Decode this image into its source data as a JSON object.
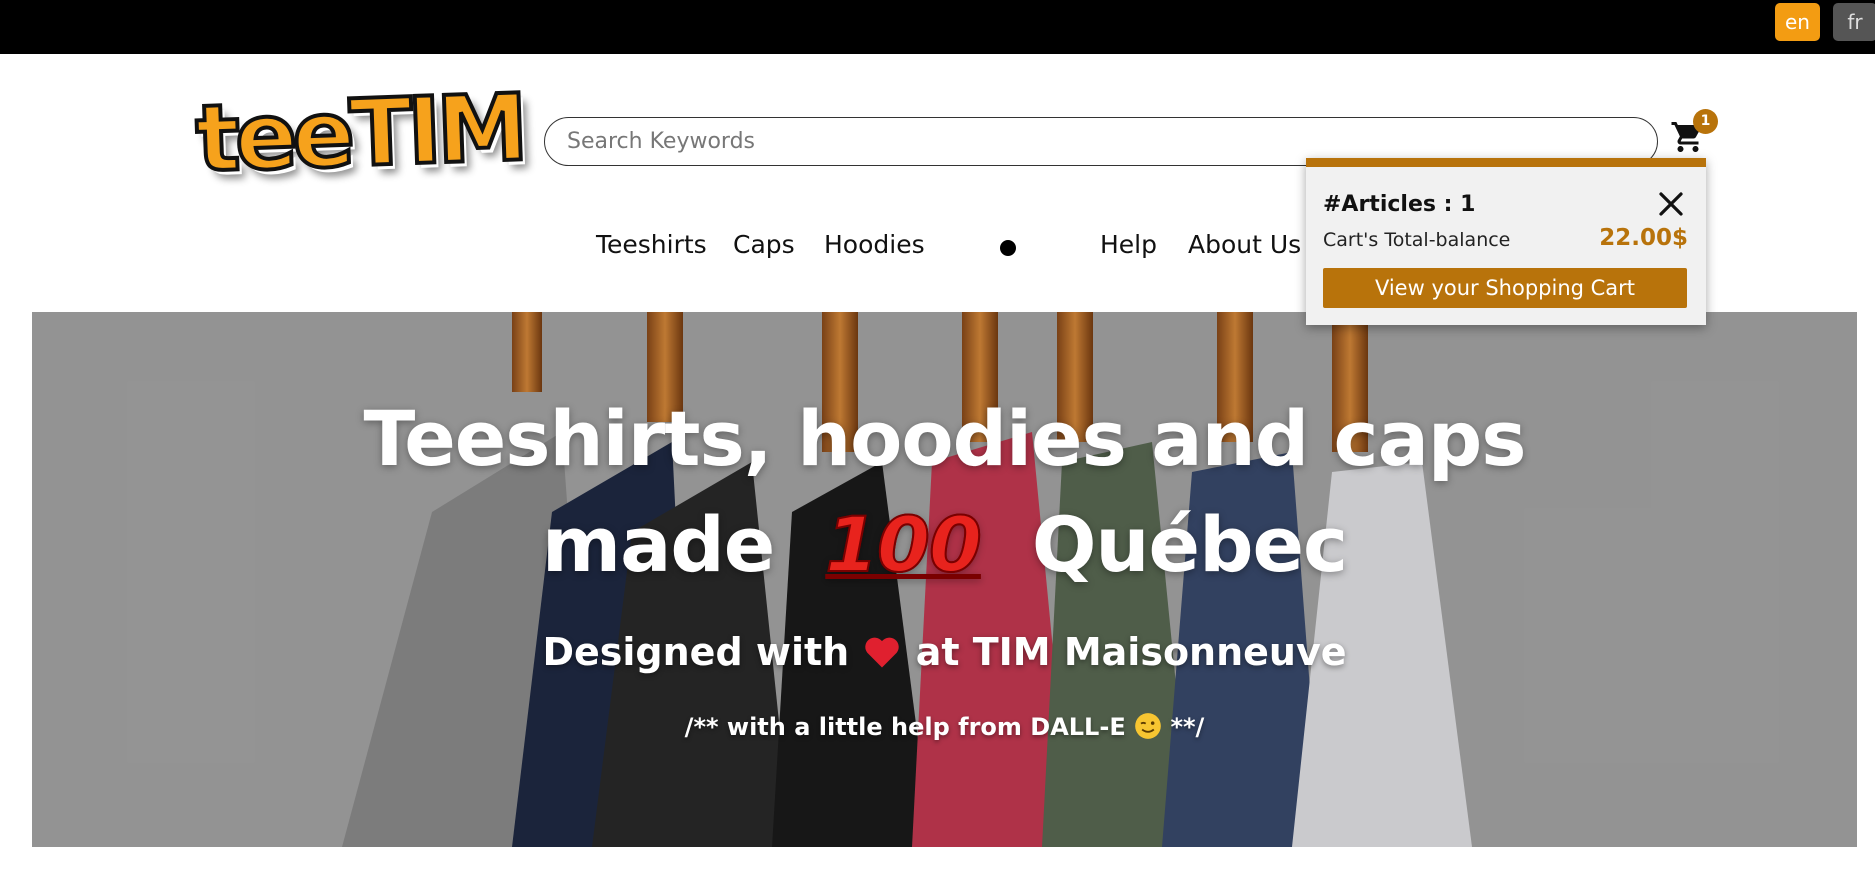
{
  "language": {
    "en": "en",
    "fr": "fr"
  },
  "logo": {
    "text": "teeTIM"
  },
  "search": {
    "placeholder": "Search Keywords"
  },
  "cart": {
    "count": "1"
  },
  "nav": {
    "items": [
      {
        "label": "Teeshirts"
      },
      {
        "label": "Caps"
      },
      {
        "label": "Hoodies"
      },
      {
        "label": "Help"
      },
      {
        "label": "About Us"
      }
    ]
  },
  "hero": {
    "line1": "Teeshirts, hoodies and caps",
    "line2_start": "made",
    "emoji": "100",
    "line2_end": "Québec",
    "subtitle_start": "Designed with",
    "subtitle_end": "at TIM Maisonneuve",
    "note_start": "/** with a little help from DALL-E",
    "note_end": "**/"
  },
  "cart_popup": {
    "articles": "#Articles : 1",
    "balance_label": "Cart's Total-balance",
    "balance_value": "22.00$",
    "view_button": "View your Shopping Cart"
  },
  "colors": {
    "accent": "#f39c12",
    "brand_brown": "#b8730b",
    "top_bar": "#000000"
  }
}
